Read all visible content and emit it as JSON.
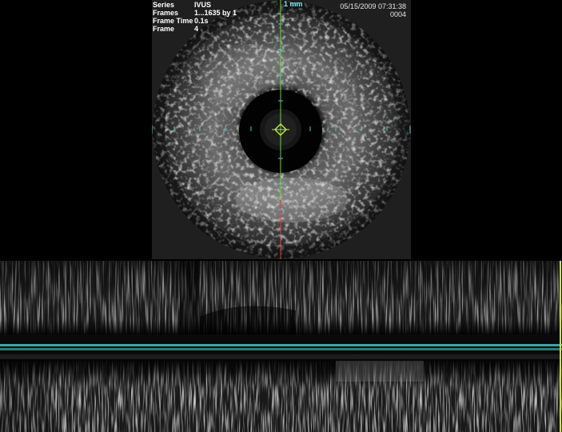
{
  "series_info": {
    "series_label": "Series",
    "series_value": "IVUS",
    "frames_label": "Frames",
    "frames_value": "1...1635 by 1",
    "frame_time_label": "Frame Time",
    "frame_time_value": "0.1s",
    "frame_label": "Frame",
    "frame_value": "4"
  },
  "header": {
    "datetime": "05/15/2009 07:31:38",
    "image_number": "0004"
  },
  "scale": {
    "label": "1 mm"
  },
  "colors": {
    "background": "#000000",
    "crosshair_vertical": "#6ad24a",
    "crosshair_red": "#e04040",
    "separator_band": "#3aa6a0",
    "marker": "#d4e046"
  },
  "views": {
    "cross_section": "ivus-cross-section",
    "longitudinal_upper": "longitudinal-view-upper",
    "longitudinal_lower": "longitudinal-view-lower"
  }
}
